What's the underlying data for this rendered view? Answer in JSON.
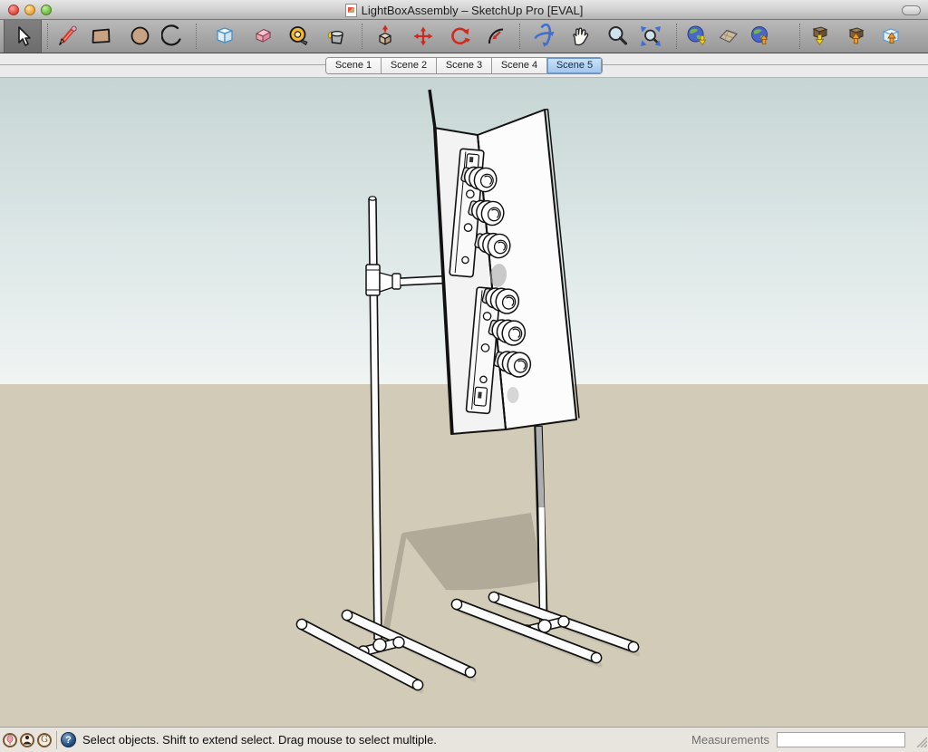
{
  "window": {
    "title": "LightBoxAssembly – SketchUp Pro [EVAL]"
  },
  "toolbar": {
    "tools": [
      "select",
      "line",
      "rectangle",
      "circle",
      "arc",
      "make-component",
      "eraser",
      "tape-measure",
      "paint-bucket",
      "push-pull",
      "move",
      "rotate",
      "offset",
      "orbit",
      "pan",
      "zoom",
      "zoom-extents",
      "add-location",
      "toggle-terrain",
      "place-model",
      "get-models",
      "share-model",
      "share-component"
    ],
    "active_tool": "select"
  },
  "tabs": {
    "items": [
      {
        "label": "Scene 1"
      },
      {
        "label": "Scene 2"
      },
      {
        "label": "Scene 3"
      },
      {
        "label": "Scene 4"
      },
      {
        "label": "Scene 5"
      }
    ],
    "active_label": "Scene 5"
  },
  "statusbar": {
    "hint": "Select objects. Shift to extend select. Drag mouse to select multiple.",
    "measurements_label": "Measurements",
    "measurements_value": ""
  },
  "colors": {
    "sky_top": "#c6d5d3",
    "sky_horizon": "#f0f4f3",
    "ground": "#d2cbb7",
    "shadow": "#b1aa99",
    "active_tab": "#9fc5ec"
  }
}
